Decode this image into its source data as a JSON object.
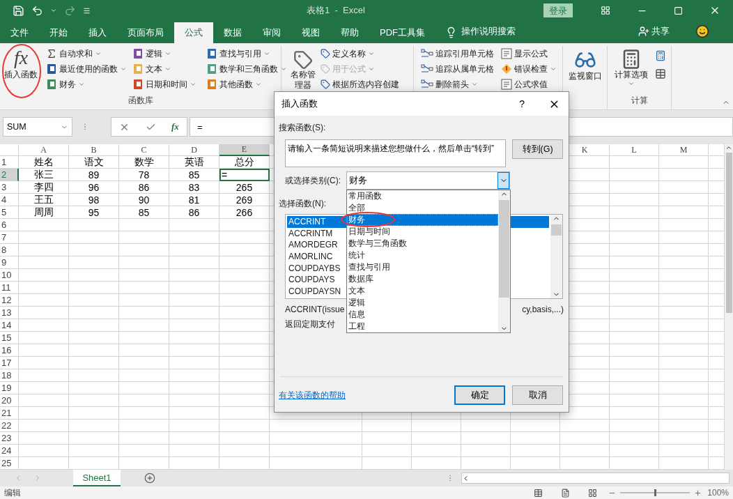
{
  "title_bar": {
    "title": "表格1  -  Excel",
    "sign_in": "登录"
  },
  "tabs": [
    {
      "label": "文件",
      "selected": false
    },
    {
      "label": "开始",
      "selected": false
    },
    {
      "label": "插入",
      "selected": false
    },
    {
      "label": "页面布局",
      "selected": false
    },
    {
      "label": "公式",
      "selected": true
    },
    {
      "label": "数据",
      "selected": false
    },
    {
      "label": "审阅",
      "selected": false
    },
    {
      "label": "视图",
      "selected": false
    },
    {
      "label": "帮助",
      "selected": false
    },
    {
      "label": "PDF工具集",
      "selected": false
    }
  ],
  "tell_me": "操作说明搜索",
  "share": "共享",
  "ribbon": {
    "insert_function": {
      "glyph": "fx",
      "label": "插入函数"
    },
    "library": {
      "label": "函数库",
      "columns": [
        [
          {
            "label": "自动求和",
            "dropdown": true
          },
          {
            "label": "最近使用的函数",
            "dropdown": true
          },
          {
            "label": "财务",
            "dropdown": true
          }
        ],
        [
          {
            "label": "逻辑",
            "dropdown": true
          },
          {
            "label": "文本",
            "dropdown": true
          },
          {
            "label": "日期和时间",
            "dropdown": true
          }
        ],
        [
          {
            "label": "查找与引用",
            "dropdown": true
          },
          {
            "label": "数学和三角函数",
            "dropdown": true
          },
          {
            "label": "其他函数",
            "dropdown": true
          }
        ]
      ]
    },
    "names": {
      "manager": "名称管理器",
      "items": [
        {
          "label": "定义名称",
          "dropdown": true,
          "disabled": false
        },
        {
          "label": "用于公式",
          "dropdown": true,
          "disabled": true
        },
        {
          "label": "根据所选内容创建",
          "dropdown": false,
          "disabled": false
        }
      ]
    },
    "auditing": {
      "columns": [
        [
          {
            "label": "追踪引用单元格",
            "dropdown": false
          },
          {
            "label": "追踪从属单元格",
            "dropdown": false
          },
          {
            "label": "删除箭头",
            "dropdown": true
          }
        ],
        [
          {
            "label": "显示公式",
            "dropdown": false
          },
          {
            "label": "错误检查",
            "dropdown": true
          },
          {
            "label": "公式求值",
            "dropdown": false
          }
        ]
      ]
    },
    "watch_window": "监视窗口",
    "calculation": {
      "options": "计算选项",
      "label": "计算"
    }
  },
  "formula_bar": {
    "name_box": "SUM",
    "fx": "fx",
    "formula": "="
  },
  "sheet": {
    "columns": [
      "A",
      "B",
      "C",
      "D",
      "E",
      "K",
      "L",
      "M"
    ],
    "row_numbers": [
      "1",
      "2",
      "3",
      "4",
      "5",
      "6",
      "7",
      "8",
      "9",
      "10",
      "11",
      "12",
      "13",
      "14",
      "15",
      "16",
      "17",
      "18",
      "19",
      "20",
      "21",
      "22",
      "23",
      "24",
      "25"
    ],
    "rows": [
      {
        "cells": [
          {
            "text": "姓名",
            "selected": false
          },
          {
            "text": "语文",
            "selected": false
          },
          {
            "text": "数学",
            "selected": false
          },
          {
            "text": "英语",
            "selected": false
          },
          {
            "text": "总分",
            "selected": false
          }
        ]
      },
      {
        "cells": [
          {
            "text": "张三",
            "selected": false
          },
          {
            "text": "89",
            "selected": false
          },
          {
            "text": "78",
            "selected": false
          },
          {
            "text": "85",
            "selected": false
          },
          {
            "text": "=",
            "selected": true
          }
        ]
      },
      {
        "cells": [
          {
            "text": "李四",
            "selected": false
          },
          {
            "text": "96",
            "selected": false
          },
          {
            "text": "86",
            "selected": false
          },
          {
            "text": "83",
            "selected": false
          },
          {
            "text": "265",
            "selected": false
          }
        ]
      },
      {
        "cells": [
          {
            "text": "王五",
            "selected": false
          },
          {
            "text": "98",
            "selected": false
          },
          {
            "text": "90",
            "selected": false
          },
          {
            "text": "81",
            "selected": false
          },
          {
            "text": "269",
            "selected": false
          }
        ]
      },
      {
        "cells": [
          {
            "text": "周周",
            "selected": false
          },
          {
            "text": "95",
            "selected": false
          },
          {
            "text": "85",
            "selected": false
          },
          {
            "text": "86",
            "selected": false
          },
          {
            "text": "266",
            "selected": false
          }
        ]
      }
    ]
  },
  "dialog": {
    "title": "插入函数",
    "help": "?",
    "search_label": "搜索函数(S):",
    "search_value": "请输入一条简短说明来描述您想做什么，然后单击“转到”",
    "go": "转到(G)",
    "category_label": "或选择类别(C):",
    "category_value": "财务",
    "category_options": [
      {
        "label": "常用函数",
        "selected": false
      },
      {
        "label": "全部",
        "selected": false
      },
      {
        "label": "财务",
        "selected": true
      },
      {
        "label": "日期与时间",
        "selected": false
      },
      {
        "label": "数学与三角函数",
        "selected": false
      },
      {
        "label": "统计",
        "selected": false
      },
      {
        "label": "查找与引用",
        "selected": false
      },
      {
        "label": "数据库",
        "selected": false
      },
      {
        "label": "文本",
        "selected": false
      },
      {
        "label": "逻辑",
        "selected": false
      },
      {
        "label": "信息",
        "selected": false
      },
      {
        "label": "工程",
        "selected": false
      }
    ],
    "function_label": "选择函数(N):",
    "functions": [
      {
        "label": "ACCRINT",
        "selected": true
      },
      {
        "label": "ACCRINTM",
        "selected": false
      },
      {
        "label": "AMORDEGR",
        "selected": false
      },
      {
        "label": "AMORLINC",
        "selected": false
      },
      {
        "label": "COUPDAYBS",
        "selected": false
      },
      {
        "label": "COUPDAYS",
        "selected": false
      },
      {
        "label": "COUPDAYSN",
        "selected": false
      }
    ],
    "syntax_start": "ACCRINT(issue",
    "syntax_end": "cy,basis,...)",
    "description": "返回定期支付",
    "help_link": "有关该函数的帮助",
    "ok": "确定",
    "cancel": "取消"
  },
  "sheet_tabs": [
    {
      "label": "Sheet1",
      "selected": true
    }
  ],
  "status_bar": {
    "mode": "编辑",
    "zoom": {
      "level": 0.5,
      "reading": "100%"
    }
  }
}
